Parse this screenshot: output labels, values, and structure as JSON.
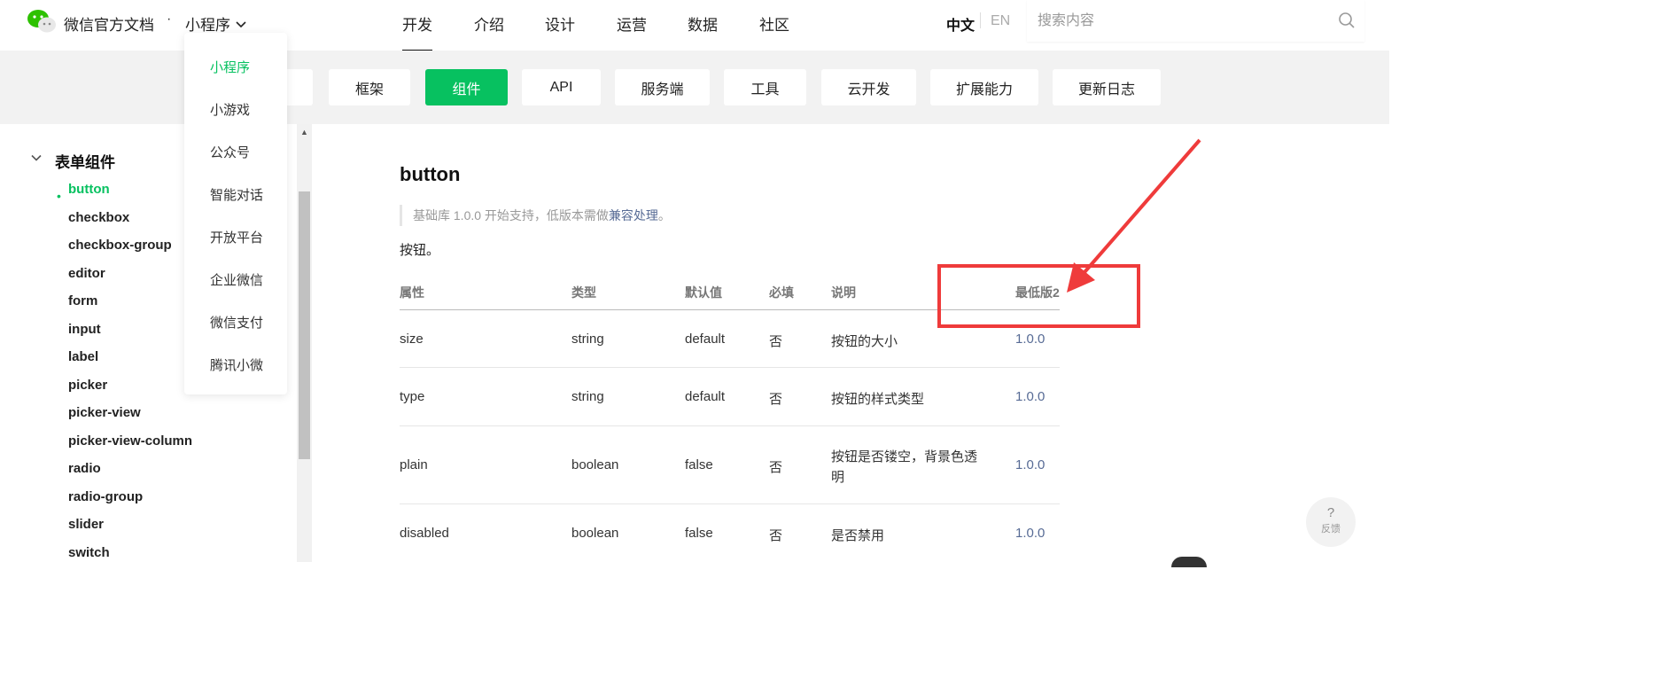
{
  "header": {
    "brand": "微信官方文档",
    "separator": "·",
    "product": "小程序",
    "nav": [
      "开发",
      "介绍",
      "设计",
      "运营",
      "数据",
      "社区"
    ],
    "lang_zh": "中文",
    "lang_en": "EN",
    "search_placeholder": "搜索内容",
    "brand_color": "#07c160"
  },
  "subnav": {
    "tabs": [
      "框架",
      "组件",
      "API",
      "服务端",
      "工具",
      "云开发",
      "扩展能力",
      "更新日志"
    ],
    "active": "组件"
  },
  "dropdown": {
    "items": [
      "小程序",
      "小游戏",
      "公众号",
      "智能对话",
      "开放平台",
      "企业微信",
      "微信支付",
      "腾讯小微"
    ],
    "active": "小程序"
  },
  "sidebar": {
    "group": "表单组件",
    "items": [
      "button",
      "checkbox",
      "checkbox-group",
      "editor",
      "form",
      "input",
      "label",
      "picker",
      "picker-view",
      "picker-view-column",
      "radio",
      "radio-group",
      "slider",
      "switch"
    ],
    "active": "button"
  },
  "content": {
    "title": "button",
    "note_prefix": "基础库 1.0.0 开始支持，低版本需做",
    "note_link": "兼容处理",
    "note_suffix": "。",
    "desc": "按钮。",
    "table": {
      "headers": [
        "属性",
        "类型",
        "默认值",
        "必填",
        "说明",
        "最低版2"
      ],
      "rows": [
        [
          "size",
          "string",
          "default",
          "否",
          "按钮的大小",
          "1.0.0"
        ],
        [
          "type",
          "string",
          "default",
          "否",
          "按钮的样式类型",
          "1.0.0"
        ],
        [
          "plain",
          "boolean",
          "false",
          "否",
          "按钮是否镂空，背景色透明",
          "1.0.0"
        ],
        [
          "disabled",
          "boolean",
          "false",
          "否",
          "是否禁用",
          "1.0.0"
        ]
      ]
    }
  },
  "feedback": {
    "icon": "?",
    "label": "反馈"
  },
  "annotation_color": "#ef3b3b"
}
